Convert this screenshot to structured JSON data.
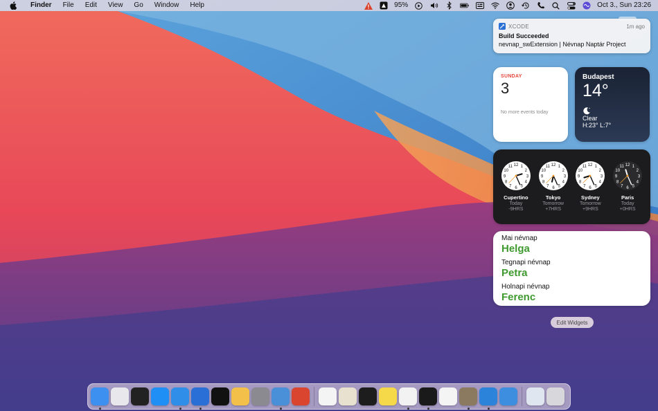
{
  "menubar": {
    "app_name": "Finder",
    "menus": [
      "File",
      "Edit",
      "View",
      "Go",
      "Window",
      "Help"
    ],
    "battery": "95%",
    "clock": "Oct 3., Sun  23:26",
    "status_icons": [
      "warning-icon",
      "password-icon",
      "play-icon",
      "volume-icon",
      "bluetooth-icon",
      "battery-icon",
      "keyboard-icon",
      "wifi-icon",
      "user-icon",
      "time-machine-icon",
      "phone-icon",
      "search-icon",
      "control-center-icon",
      "siri-icon"
    ]
  },
  "notification": {
    "app": "XCODE",
    "time": "1m ago",
    "title": "Build Succeeded",
    "body": "nevnap_swExtension | Névnap Naptár Project"
  },
  "calendar_widget": {
    "weekday": "SUNDAY",
    "day": "3",
    "events": "No more events today"
  },
  "weather_widget": {
    "city": "Budapest",
    "temperature": "14°",
    "condition": "Clear",
    "high_low": "H:23° L:7°"
  },
  "clock_widget": {
    "clocks": [
      {
        "city": "Cupertino",
        "day": "Today",
        "offset": "-9HRS",
        "hour": 14,
        "minute": 26,
        "dark": false
      },
      {
        "city": "Tokyo",
        "day": "Tomorrow",
        "offset": "+7HRS",
        "hour": 6,
        "minute": 26,
        "dark": false
      },
      {
        "city": "Sydney",
        "day": "Tomorrow",
        "offset": "+9HRS",
        "hour": 8,
        "minute": 26,
        "dark": false
      },
      {
        "city": "Paris",
        "day": "Today",
        "offset": "+0HRS",
        "hour": 23,
        "minute": 26,
        "dark": true
      }
    ]
  },
  "nevnap_widget": {
    "today_label": "Mai névnap",
    "today_name": "Helga",
    "yesterday_label": "Tegnapi névnap",
    "yesterday_name": "Petra",
    "tomorrow_label": "Holnapi névnap",
    "tomorrow_name": "Ferenc"
  },
  "edit_widgets_label": "Edit Widgets",
  "dock": {
    "apps": [
      {
        "name": "finder-icon",
        "color": "#3d8ff0",
        "running": true
      },
      {
        "name": "launchpad-icon",
        "color": "#e8e8ec",
        "running": false
      },
      {
        "name": "mission-control-icon",
        "color": "#222222",
        "running": false
      },
      {
        "name": "app-store-icon",
        "color": "#1f8ff5",
        "running": false
      },
      {
        "name": "safari-icon",
        "color": "#2f8fe8",
        "running": true
      },
      {
        "name": "xcode-icon",
        "color": "#2a6fd6",
        "running": true
      },
      {
        "name": "apple-tv-icon",
        "color": "#111111",
        "running": false
      },
      {
        "name": "photos-icon",
        "color": "#f3c04a",
        "running": false
      },
      {
        "name": "system-preferences-icon",
        "color": "#8a8a90",
        "running": false
      },
      {
        "name": "automator-icon",
        "color": "#4a90d9",
        "running": true
      },
      {
        "name": "instruments-icon",
        "color": "#d9452f",
        "running": false
      },
      {
        "name": "textedit-icon",
        "color": "#f4f4f4",
        "running": false
      },
      {
        "name": "script-editor-icon",
        "color": "#e9e1d0",
        "running": false
      },
      {
        "name": "activity-monitor-icon",
        "color": "#1d1d1d",
        "running": false
      },
      {
        "name": "notes-icon",
        "color": "#f6d948",
        "running": false
      },
      {
        "name": "chrome-icon",
        "color": "#f2f2f2",
        "running": true
      },
      {
        "name": "terminal-icon",
        "color": "#1a1a1a",
        "running": true
      },
      {
        "name": "numbers-icon",
        "color": "#f4f4f4",
        "running": false
      },
      {
        "name": "gimp-icon",
        "color": "#8b7a5f",
        "running": true
      },
      {
        "name": "xcode-alt-icon",
        "color": "#2b84d9",
        "running": true
      },
      {
        "name": "simulator-icon",
        "color": "#3e8ee0",
        "running": false
      },
      {
        "name": "preview-icon",
        "color": "#dfe6ef",
        "running": false
      },
      {
        "name": "trash-icon",
        "color": "#d8d8dc",
        "running": false
      }
    ]
  }
}
